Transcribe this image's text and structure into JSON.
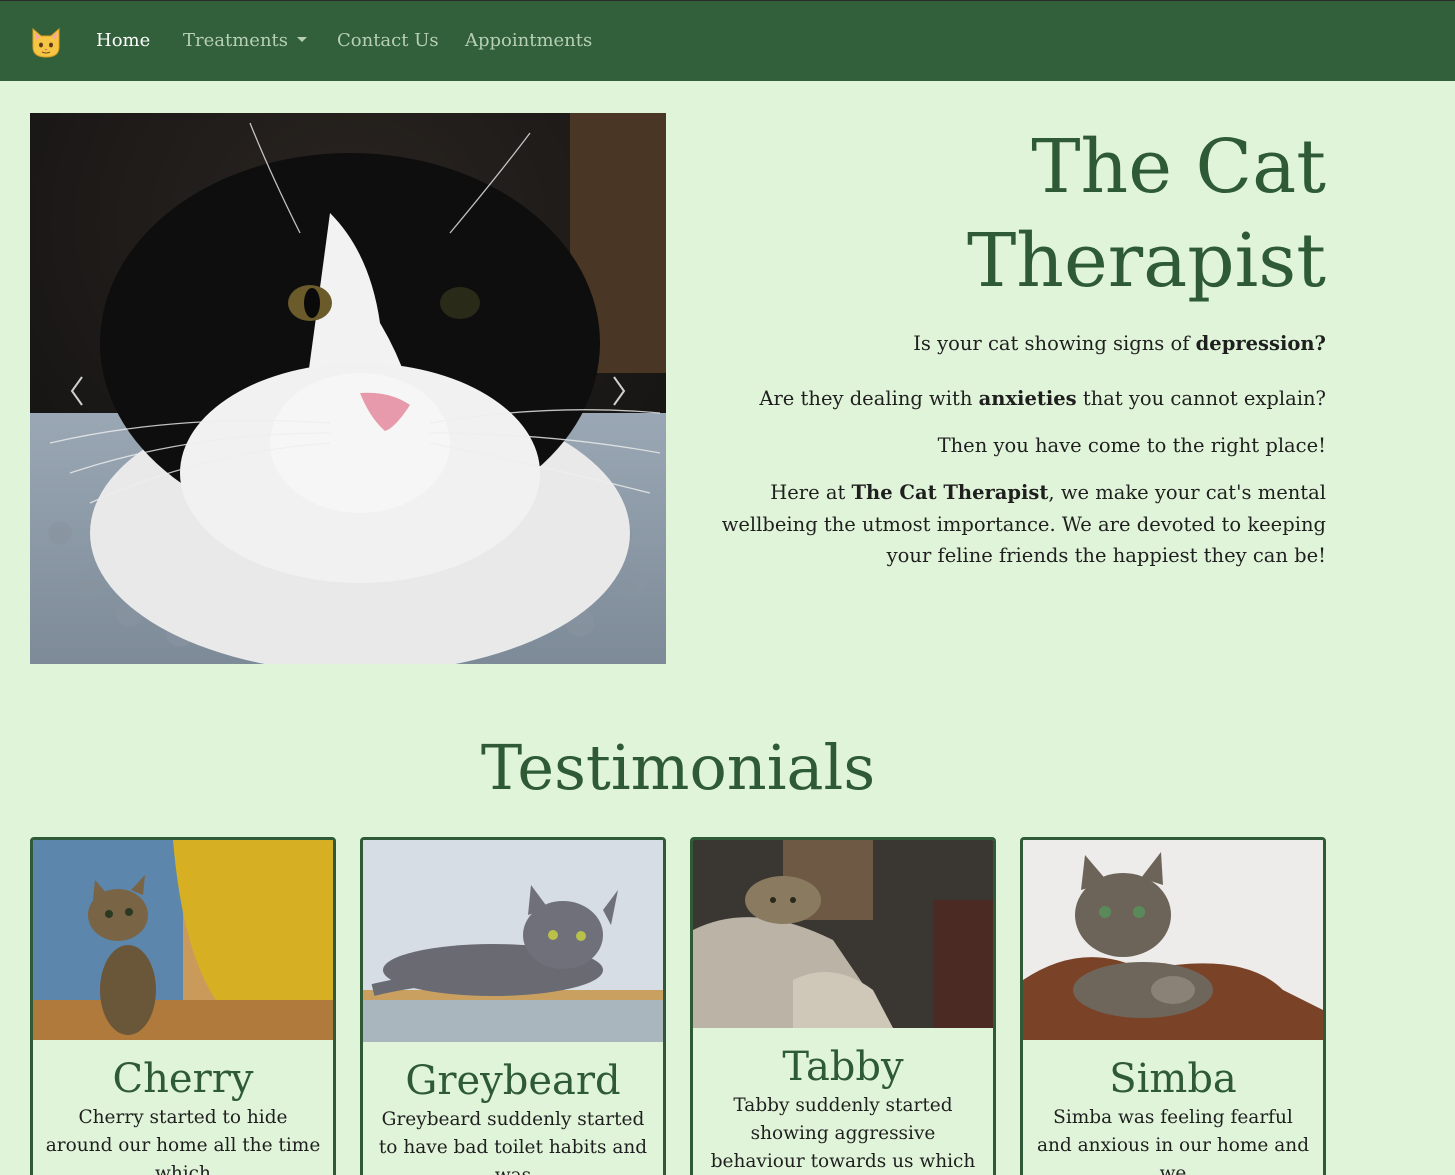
{
  "nav": {
    "brand_icon": "cat-face-icon",
    "items": [
      {
        "label": "Home",
        "active": true
      },
      {
        "label": "Treatments",
        "has_dropdown": true
      },
      {
        "label": "Contact Us"
      },
      {
        "label": "Appointments"
      }
    ]
  },
  "carousel": {
    "prev_icon": "chevron-left-icon",
    "next_icon": "chevron-right-icon"
  },
  "hero": {
    "title_line1": "The Cat",
    "title_line2": "Therapist",
    "p1_prefix": "Is your cat showing signs of ",
    "p1_bold": "depression?",
    "p2_prefix": "Are they dealing with ",
    "p2_bold": "anxieties",
    "p2_suffix": " that you cannot explain?",
    "p3": "Then you have come to the right place!",
    "p4_prefix": "Here at ",
    "p4_bold": "The Cat Therapist",
    "p4_suffix": ", we make your cat's mental wellbeing the utmost importance. We are devoted to keeping your feline friends the happiest they can be!"
  },
  "testimonials": {
    "heading": "Testimonials",
    "cards": [
      {
        "name": "Cherry",
        "text": "Cherry started to hide around our home all the time which"
      },
      {
        "name": "Greybeard",
        "text": "Greybeard suddenly started to have bad toilet habits and was"
      },
      {
        "name": "Tabby",
        "text": "Tabby suddenly started showing aggressive behaviour towards us which was"
      },
      {
        "name": "Simba",
        "text": "Simba was feeling fearful and anxious in our home and we"
      }
    ]
  },
  "colors": {
    "navbar": "#31603a",
    "background": "#e0f4d9",
    "accent": "#2e5b35"
  }
}
